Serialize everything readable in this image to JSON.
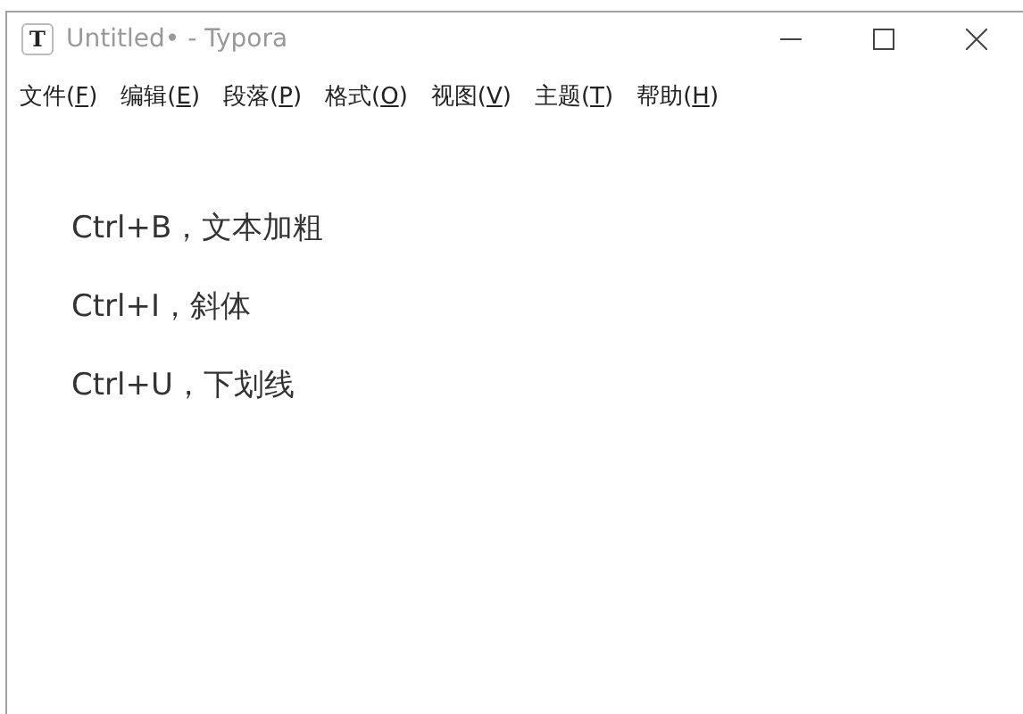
{
  "window": {
    "app_icon": "T",
    "title": "Untitled• - Typora"
  },
  "menu": [
    {
      "before": "文件(",
      "key": "F",
      "after": ")"
    },
    {
      "before": "编辑(",
      "key": "E",
      "after": ")"
    },
    {
      "before": "段落(",
      "key": "P",
      "after": ")"
    },
    {
      "before": "格式(",
      "key": "O",
      "after": ")"
    },
    {
      "before": "视图(",
      "key": "V",
      "after": ")"
    },
    {
      "before": "主题(",
      "key": "T",
      "after": ")"
    },
    {
      "before": "帮助(",
      "key": "H",
      "after": ")"
    }
  ],
  "paragraphs": [
    "Ctrl+B，文本加粗",
    "Ctrl+I，斜体",
    "Ctrl+U，下划线"
  ]
}
